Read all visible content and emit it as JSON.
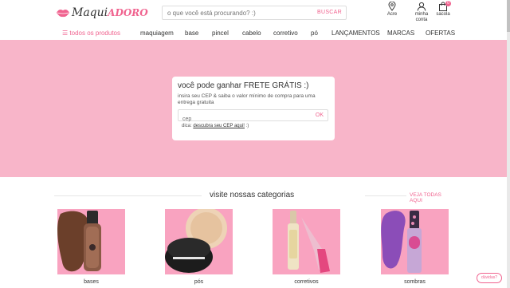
{
  "header": {
    "logo_main": "Maqui",
    "logo_accent": "ADORO",
    "search_placeholder": "o que você está procurando? :)",
    "search_button": "BUSCAR",
    "location_label": "Acre",
    "account_label_1": "minha",
    "account_label_2": "conta",
    "bag_label": "sacola",
    "bag_count": "0"
  },
  "nav": {
    "all_products": "todos os produtos",
    "items": [
      "maquiagem",
      "base",
      "pincel",
      "cabelo",
      "corretivo",
      "pó",
      "LANÇAMENTOS",
      "MARCAS",
      "OFERTAS"
    ]
  },
  "cep": {
    "title": "você pode ganhar FRETE GRÁTIS :)",
    "description": "insira seu CEP & saiba o valor mínimo de compra para uma entrega gratuita",
    "placeholder": "cep",
    "ok": "OK",
    "tip_prefix": "dica:",
    "tip_link": "descubra seu CEP aqui!",
    "tip_suffix": ":)"
  },
  "categories": {
    "title": "visite nossas categorias",
    "see_all": "VEJA TODAS AQUI",
    "items": [
      {
        "label": "bases"
      },
      {
        "label": "pós"
      },
      {
        "label": "corretivos"
      },
      {
        "label": "sombras"
      }
    ]
  },
  "chat_button": "dúvidas?",
  "colors": {
    "brand_pink": "#f0638f",
    "hero_pink": "#f8b5c9",
    "tile_pink": "#f9a3c0"
  }
}
